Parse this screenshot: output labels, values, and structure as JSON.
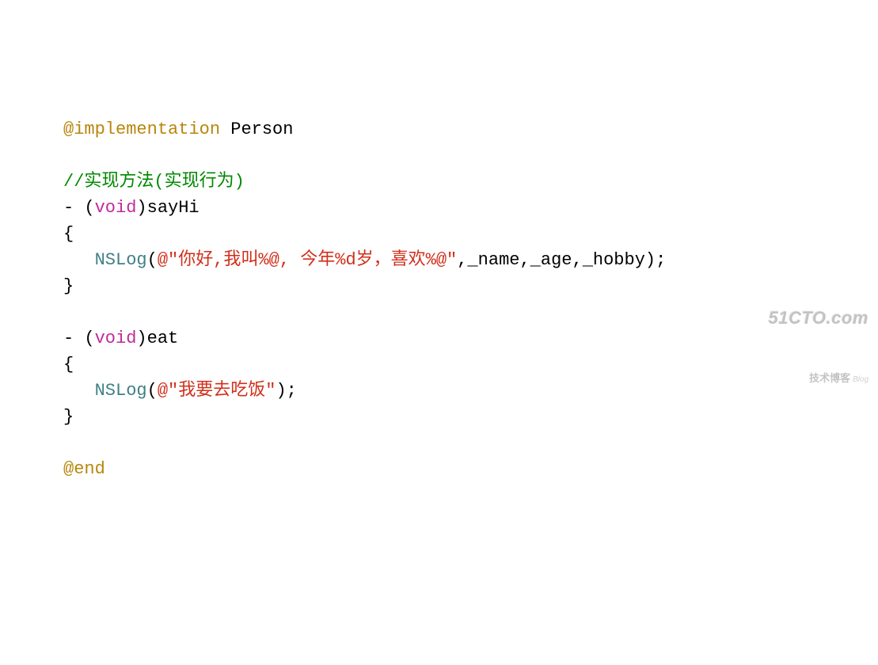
{
  "code": {
    "line1": {
      "directive": "@implementation",
      "classname": "Person"
    },
    "line2_caret": "^",
    "line3": {
      "comment": "//实现方法(实现行为)"
    },
    "line4": {
      "prefix": "- (",
      "type": "void",
      "suffix": ")sayHi"
    },
    "line5": "{",
    "line6": {
      "indent": "   ",
      "func": "NSLog",
      "open": "(",
      "string": "@\"你好,我叫%@, 今年%d岁，喜欢%@\"",
      "args": ",_name,_age,_hobby);",
      "close": ""
    },
    "line7": "}",
    "line8": "",
    "line9": {
      "prefix": "- (",
      "type": "void",
      "suffix": ")eat"
    },
    "line10": "{",
    "line11": {
      "indent": "   ",
      "func": "NSLog",
      "open": "(",
      "string": "@\"我要去吃饭\"",
      "args": ");",
      "close": ""
    },
    "line12": "}",
    "line13": "",
    "line14": {
      "directive": "@end"
    }
  },
  "watermark": {
    "top": "51CTO.com",
    "bottom": "技术博客",
    "blog": "Blog"
  }
}
